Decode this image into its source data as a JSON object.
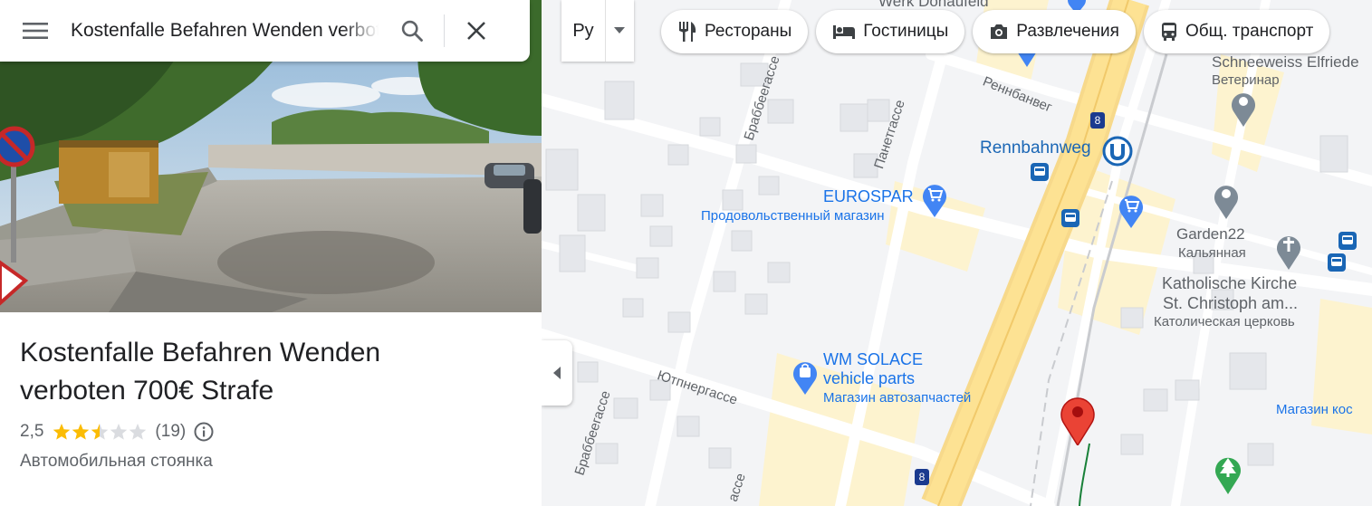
{
  "search": {
    "query": "Kostenfalle Befahren Wenden verboten 700€ Strafe"
  },
  "place": {
    "title_line1": "Kostenfalle Befahren Wenden",
    "title_line2": "verboten 700€ Strafe",
    "rating": "2,5",
    "stars_filled": 2.5,
    "stars_total": 5,
    "review_count": "(19)",
    "category": "Автомобильная стоянка"
  },
  "map": {
    "language_label": "Ру",
    "chips": [
      {
        "icon": "fork-knife-icon",
        "label": "Рестораны"
      },
      {
        "icon": "bed-icon",
        "label": "Гостиницы"
      },
      {
        "icon": "camera-icon",
        "label": "Развлечения"
      },
      {
        "icon": "bus-icon",
        "label": "Общ. транспорт"
      }
    ],
    "labels": {
      "werk": "Werk Donaufeld",
      "schneeweiss": "Schneeweiss Elfriede",
      "veterinar": "Ветеринар",
      "rennbahnweg": "Rennbahnweg",
      "eurospar": "EUROSPAR",
      "eurospar_sub": "Продовольственный магазин",
      "garden22": "Garden22",
      "garden22_sub": "Кальянная",
      "kirche1": "Katholische Kirche",
      "kirche2": "St. Christoph am...",
      "kirche_sub": "Католическая церковь",
      "wm1": "WM SOLACE",
      "wm2": "vehicle parts",
      "wm_sub": "Магазин автозапчастей",
      "magazin_kos": "Магазин кос",
      "route8_top": "8",
      "route8_bottom": "8"
    },
    "streets": {
      "brabbee_top": "Браббеегассе",
      "rennbanweg": "Реннбанвег",
      "panettasse": "Панетгассе",
      "yutnergasse": "Ютпнергассе",
      "brabbee_bottom": "Браббеегассе",
      "bottom_street": "ассе"
    }
  },
  "colors": {
    "accent_blue": "#1a73e8",
    "pin_red": "#ea4335",
    "star_gold": "#fbbc04",
    "highway_yellow": "#fde293"
  }
}
